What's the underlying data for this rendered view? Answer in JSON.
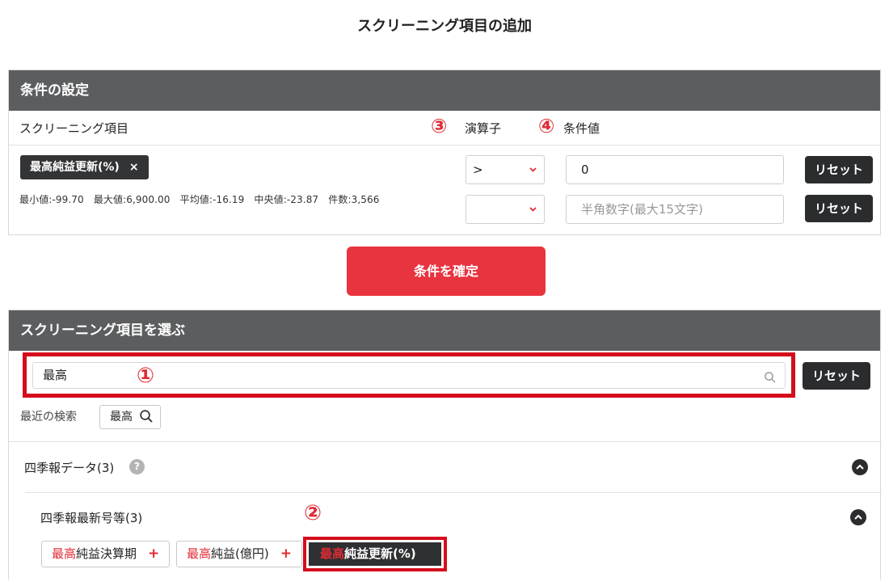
{
  "page_title": "スクリーニング項目の追加",
  "conditions_panel": {
    "header": "条件の設定",
    "col_item": "スクリーニング項目",
    "col_operator": "演算子",
    "col_value": "条件値",
    "marker_operator": "③",
    "marker_value": "④",
    "selected_item": "最高純益更新(%)",
    "remove_glyph": "×",
    "stats": "最小値:-99.70　最大値:6,900.00　平均値:-16.19　中央値:-23.87　件数:3,566",
    "rows": [
      {
        "operator": ">",
        "value": "0",
        "placeholder": "",
        "reset_label": "リセット"
      },
      {
        "operator": "",
        "value": "",
        "placeholder": "半角数字(最大15文字)",
        "reset_label": "リセット"
      }
    ]
  },
  "confirm_button": "条件を確定",
  "select_panel": {
    "header": "スクリーニング項目を選ぶ",
    "search_value": "最高",
    "marker_search": "①",
    "reset_label": "リセット",
    "recent_label": "最近の検索",
    "recent_items": [
      "最高"
    ],
    "category": {
      "label": "四季報データ(3)",
      "help": "?"
    },
    "subcategory": {
      "label": "四季報最新号等(3)"
    },
    "marker_result": "②",
    "results": [
      {
        "highlight": "最高",
        "rest": "純益決算期",
        "selected": false,
        "add": "+"
      },
      {
        "highlight": "最高",
        "rest": "純益(億円)",
        "selected": false,
        "add": "+"
      },
      {
        "highlight": "最高",
        "rest": "純益更新(%)",
        "selected": true,
        "add": ""
      }
    ]
  },
  "colors": {
    "header_bg": "#5b5d5f",
    "accent_red": "#e8343f",
    "annotation_red": "#d50d1b",
    "dark_button": "#2b2c2e"
  },
  "icons": [
    "search-icon",
    "close-icon",
    "chevron-down-icon",
    "chevron-up-icon",
    "help-icon",
    "plus-icon"
  ]
}
